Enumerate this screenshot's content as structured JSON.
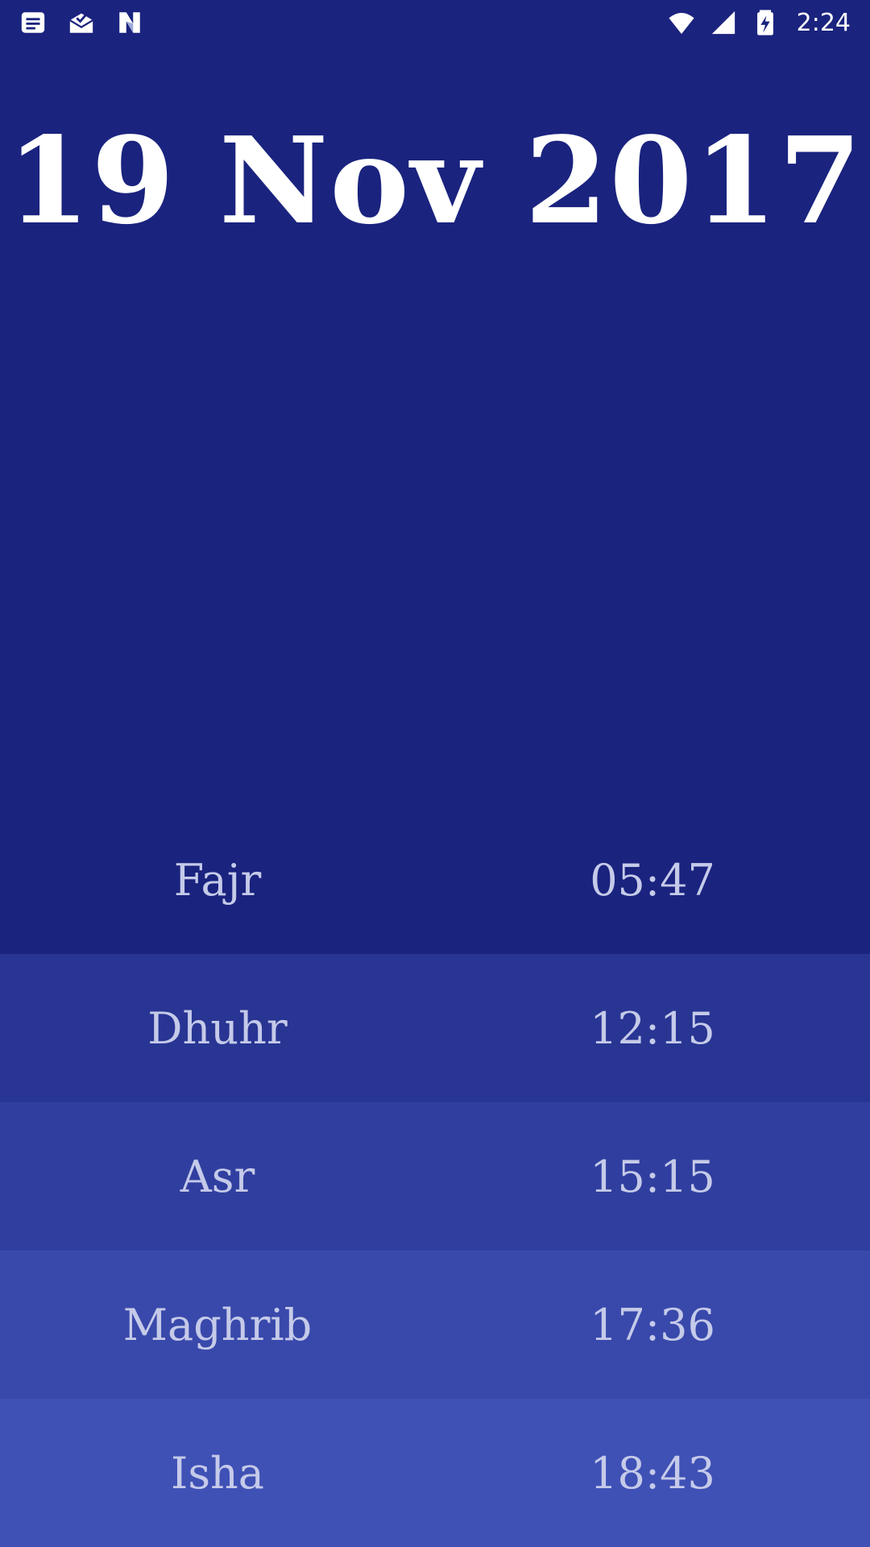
{
  "status_bar": {
    "left_icons": [
      "notes-icon",
      "mail-icon",
      "n-app-icon"
    ],
    "right_icons": [
      "wifi-icon",
      "signal-icon",
      "battery-charging-icon"
    ],
    "time": "2:24"
  },
  "date": "19 Nov 2017",
  "prayers": [
    {
      "name": "Fajr",
      "time": "05:47"
    },
    {
      "name": "Dhuhr",
      "time": "12:15"
    },
    {
      "name": "Asr",
      "time": "15:15"
    },
    {
      "name": "Maghrib",
      "time": "17:36"
    },
    {
      "name": "Isha",
      "time": "18:43"
    }
  ],
  "colors": {
    "background": "#1a237e",
    "row_shades": [
      "#1a237e",
      "#283593",
      "#303f9f",
      "#3949ab",
      "#3f51b5"
    ],
    "text_primary": "#ffffff",
    "text_secondary": "#c5cae9"
  }
}
